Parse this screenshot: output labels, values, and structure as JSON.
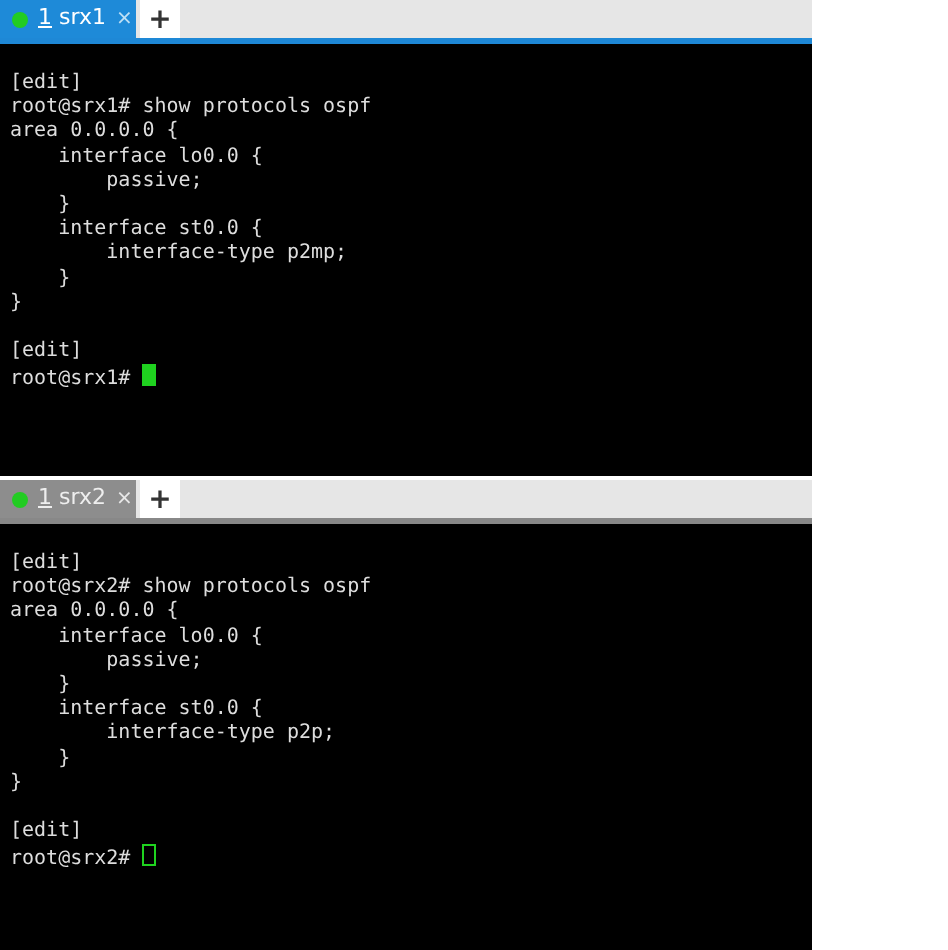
{
  "panes": [
    {
      "tab": {
        "number": "1",
        "name": "srx1",
        "close": "×",
        "selected": true
      },
      "new_tab": "+",
      "focused": true,
      "lines": [
        {
          "text": "[edit]"
        },
        {
          "text": "root@srx1# show protocols ospf"
        },
        {
          "text": "area 0.0.0.0 {"
        },
        {
          "text": "    interface lo0.0 {"
        },
        {
          "text": "        passive;"
        },
        {
          "text": "    }"
        },
        {
          "text": "    interface st0.0 {"
        },
        {
          "text": "        interface-type p2mp;"
        },
        {
          "text": "    }"
        },
        {
          "text": "}"
        },
        {
          "text": "[edit]",
          "gap_before": true
        },
        {
          "text": "root@srx1# "
        }
      ]
    },
    {
      "tab": {
        "number": "1",
        "name": "srx2",
        "close": "×",
        "selected": false
      },
      "new_tab": "+",
      "focused": false,
      "lines": [
        {
          "text": "[edit]"
        },
        {
          "text": "root@srx2# show protocols ospf"
        },
        {
          "text": "area 0.0.0.0 {"
        },
        {
          "text": "    interface lo0.0 {"
        },
        {
          "text": "        passive;"
        },
        {
          "text": "    }"
        },
        {
          "text": "    interface st0.0 {"
        },
        {
          "text": "        interface-type p2p;"
        },
        {
          "text": "    }"
        },
        {
          "text": "}"
        },
        {
          "text": "[edit]",
          "gap_before": true
        },
        {
          "text": "root@srx2# "
        }
      ]
    }
  ]
}
